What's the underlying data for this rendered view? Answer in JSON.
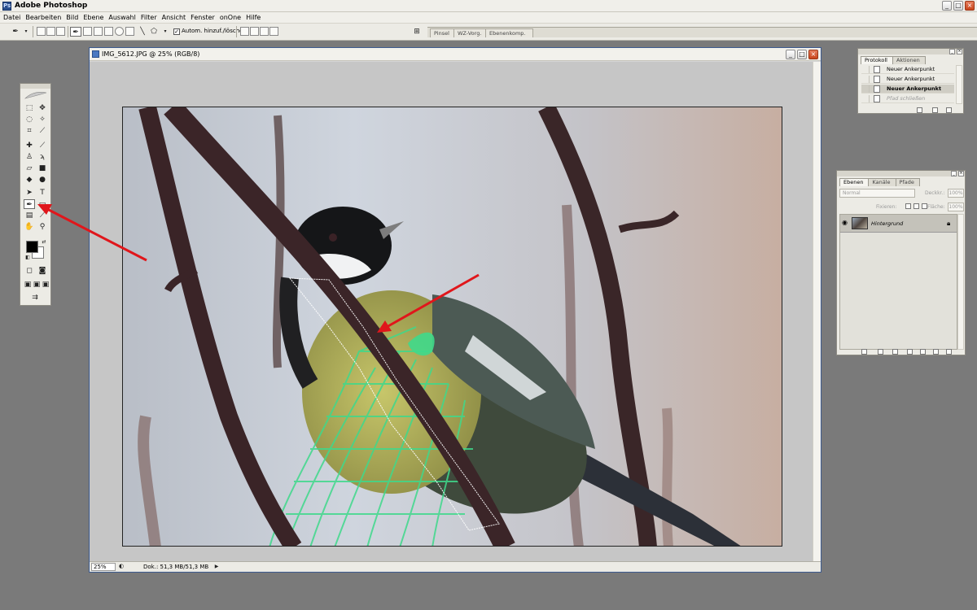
{
  "app": {
    "title": "Adobe Photoshop",
    "icon": "photoshop-icon"
  },
  "menu": [
    "Datei",
    "Bearbeiten",
    "Bild",
    "Ebene",
    "Auswahl",
    "Filter",
    "Ansicht",
    "Fenster",
    "onOne",
    "Hilfe"
  ],
  "options_bar": {
    "auto_add_delete_label": "Autom. hinzuf./löschen",
    "auto_add_delete_checked": true,
    "palette_well_tabs": [
      "Pinsel",
      "WZ-Vorg.",
      "Ebenenkomp."
    ]
  },
  "document": {
    "title": "IMG_5612.JPG @ 25% (RGB/8)",
    "zoom": "25%",
    "doc_info": "Dok.: 51,3 MB/51,3 MB",
    "active_tool": "pen-tool"
  },
  "toolbox": {
    "foreground_color": "#000000",
    "background_color": "#ffffff"
  },
  "history_palette": {
    "tabs": [
      "Protokoll",
      "Aktionen"
    ],
    "active_tab": "Protokoll",
    "items": [
      {
        "label": "Neuer Ankerpunkt",
        "state": "normal"
      },
      {
        "label": "Neuer Ankerpunkt",
        "state": "normal"
      },
      {
        "label": "Neuer Ankerpunkt",
        "state": "selected"
      },
      {
        "label": "Pfad schließen",
        "state": "dimmed"
      }
    ]
  },
  "layers_palette": {
    "tabs": [
      "Ebenen",
      "Kanäle",
      "Pfade"
    ],
    "active_tab": "Ebenen",
    "blend_mode": "Normal",
    "opacity_label": "Deckkr.:",
    "opacity_value": "100%",
    "lock_label": "Fixieren:",
    "fill_label": "Fläche:",
    "fill_value": "100%",
    "layers": [
      {
        "name": "Hintergrund",
        "visible": true,
        "locked": true
      }
    ]
  },
  "annotation": {
    "arrow_color": "#e0161b"
  }
}
